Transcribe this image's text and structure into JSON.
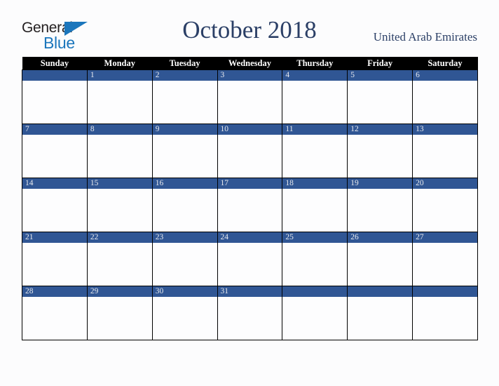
{
  "brand": {
    "logo_line1": "General",
    "logo_line2": "Blue",
    "logo_triangle_icon": "triangle-icon",
    "dark_color": "#231f20",
    "blue_color": "#1b76bc"
  },
  "header": {
    "title": "October 2018",
    "country": "United Arab Emirates",
    "title_color": "#2b3f66"
  },
  "calendar": {
    "month": "October",
    "year": "2018",
    "header_bg": "#000000",
    "header_fg": "#ffffff",
    "daynum_bg": "#305694",
    "daynum_fg": "#e8eaee",
    "cell_bg": "#fdfdfe",
    "weekday_headers": [
      "Sunday",
      "Monday",
      "Tuesday",
      "Wednesday",
      "Thursday",
      "Friday",
      "Saturday"
    ],
    "weeks": [
      [
        "",
        "1",
        "2",
        "3",
        "4",
        "5",
        "6"
      ],
      [
        "7",
        "8",
        "9",
        "10",
        "11",
        "12",
        "13"
      ],
      [
        "14",
        "15",
        "16",
        "17",
        "18",
        "19",
        "20"
      ],
      [
        "21",
        "22",
        "23",
        "24",
        "25",
        "26",
        "27"
      ],
      [
        "28",
        "29",
        "30",
        "31",
        "",
        "",
        ""
      ]
    ]
  }
}
